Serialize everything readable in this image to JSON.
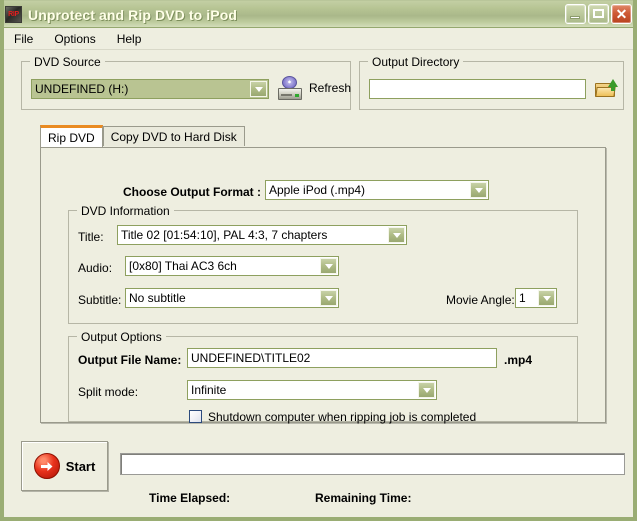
{
  "window": {
    "title": "Unprotect and Rip DVD to iPod",
    "app_icon": "RIP",
    "minimize_label": "Minimize",
    "maximize_label": "Maximize",
    "close_label": "Close"
  },
  "menubar": {
    "items": [
      {
        "label": "File"
      },
      {
        "label": "Options"
      },
      {
        "label": "Help"
      }
    ]
  },
  "dvd_source": {
    "group_title": "DVD Source",
    "drive_value": "UNDEFINED (H:)",
    "refresh_label": "Refresh"
  },
  "output_directory": {
    "group_title": "Output Directory",
    "path_value": "",
    "browse_label": "Browse"
  },
  "tabs": {
    "items": [
      {
        "label": "Rip DVD",
        "active": true
      },
      {
        "label": "Copy DVD to Hard Disk",
        "active": false
      }
    ]
  },
  "rip_tab": {
    "output_format_label": "Choose Output Format :",
    "output_format_value": "Apple iPod (.mp4)",
    "dvd_information": {
      "group_title": "DVD Information",
      "title_label": "Title:",
      "title_value": "Title 02 [01:54:10], PAL 4:3, 7 chapters",
      "audio_label": "Audio:",
      "audio_value": "[0x80] Thai AC3 6ch",
      "subtitle_label": "Subtitle:",
      "subtitle_value": "No subtitle",
      "movie_angle_label": "Movie Angle:",
      "movie_angle_value": "1"
    },
    "output_options": {
      "group_title": "Output Options",
      "file_name_label": "Output File Name:",
      "file_name_value": "UNDEFINED\\TITLE02",
      "file_extension": ".mp4",
      "split_mode_label": "Split mode:",
      "split_mode_value": "Infinite",
      "shutdown_label": "Shutdown computer when ripping job is completed",
      "shutdown_checked": false
    }
  },
  "footer": {
    "start_label": "Start",
    "progress_value": "",
    "time_elapsed_label": "Time Elapsed:",
    "time_elapsed_value": "",
    "remaining_time_label": "Remaining Time:",
    "remaining_time_value": ""
  },
  "colors": {
    "title_bar_green": "#aab88a",
    "window_frame": "#9aad74",
    "panel_bg": "#eeeee0",
    "active_tab_accent": "#e98b22",
    "control_border": "#8ea05f",
    "start_icon_red": "#e8321c",
    "close_button_red": "#cf5a36"
  }
}
